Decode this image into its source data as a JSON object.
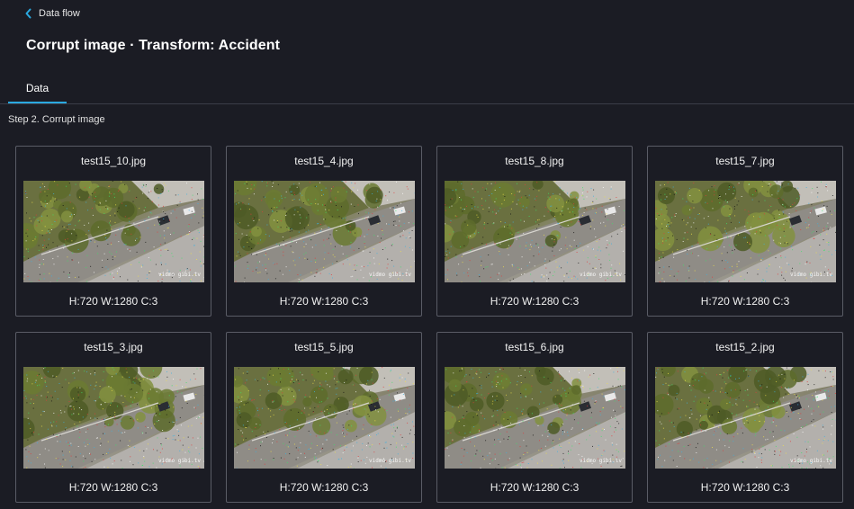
{
  "nav": {
    "back_label": "Data flow"
  },
  "page": {
    "title": "Corrupt image · Transform: Accident"
  },
  "tabs": [
    {
      "label": "Data",
      "active": true
    }
  ],
  "step": {
    "label": "Step 2. Corrupt image"
  },
  "images": [
    {
      "name": "test15_10.jpg",
      "meta": "H:720 W:1280 C:3",
      "watermark": "vidmo gibi.tv"
    },
    {
      "name": "test15_4.jpg",
      "meta": "H:720 W:1280 C:3",
      "watermark": "vidmo gibi.tv"
    },
    {
      "name": "test15_8.jpg",
      "meta": "H:720 W:1280 C:3",
      "watermark": "vidmo gibi.tv"
    },
    {
      "name": "test15_7.jpg",
      "meta": "H:720 W:1280 C:3",
      "watermark": "vidmo gibi.tv"
    },
    {
      "name": "test15_3.jpg",
      "meta": "H:720 W:1280 C:3",
      "watermark": "vidmo gibi.tv"
    },
    {
      "name": "test15_5.jpg",
      "meta": "H:720 W:1280 C:3",
      "watermark": "vidmo gibi.tv"
    },
    {
      "name": "test15_6.jpg",
      "meta": "H:720 W:1280 C:3",
      "watermark": "vidmo gibi.tv"
    },
    {
      "name": "test15_2.jpg",
      "meta": "H:720 W:1280 C:3",
      "watermark": "vidmo gibi.tv"
    }
  ],
  "colors": {
    "background": "#1b1c24",
    "accent": "#2aa9e0",
    "card_border": "#5a5c66"
  }
}
